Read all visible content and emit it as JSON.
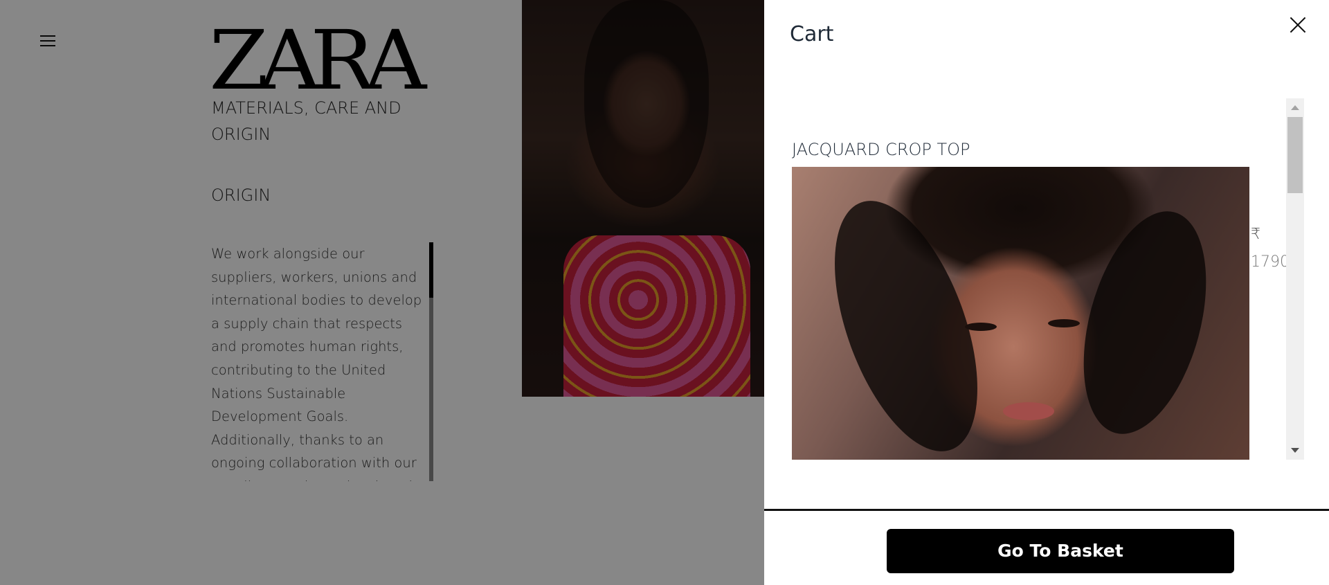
{
  "header": {
    "menu_icon": "hamburger-menu-icon",
    "logo": "ZARA"
  },
  "product_info": {
    "section_title": "MATERIALS, CARE AND ORIGIN",
    "origin_heading": "ORIGIN",
    "origin_text": "We work alongside our suppliers, workers, unions and international bodies to develop a supply chain that respects and promotes human rights, contributing to the United Nations Sustainable Development Goals. Additionally, thanks to an ongoing collaboration with our suppliers, we have developed a tracking system to collect information about the origin of our products."
  },
  "cart": {
    "title": "Cart",
    "close_icon": "close-icon",
    "items": [
      {
        "name": "JACQUARD CROP TOP",
        "currency": "₹",
        "price": "1790"
      }
    ],
    "go_to_basket_label": "Go To Basket"
  },
  "colors": {
    "overlay": "rgba(0,0,0,0.47)",
    "button_bg": "#000000",
    "button_text": "#ffffff",
    "title_text": "#1f2a37"
  }
}
